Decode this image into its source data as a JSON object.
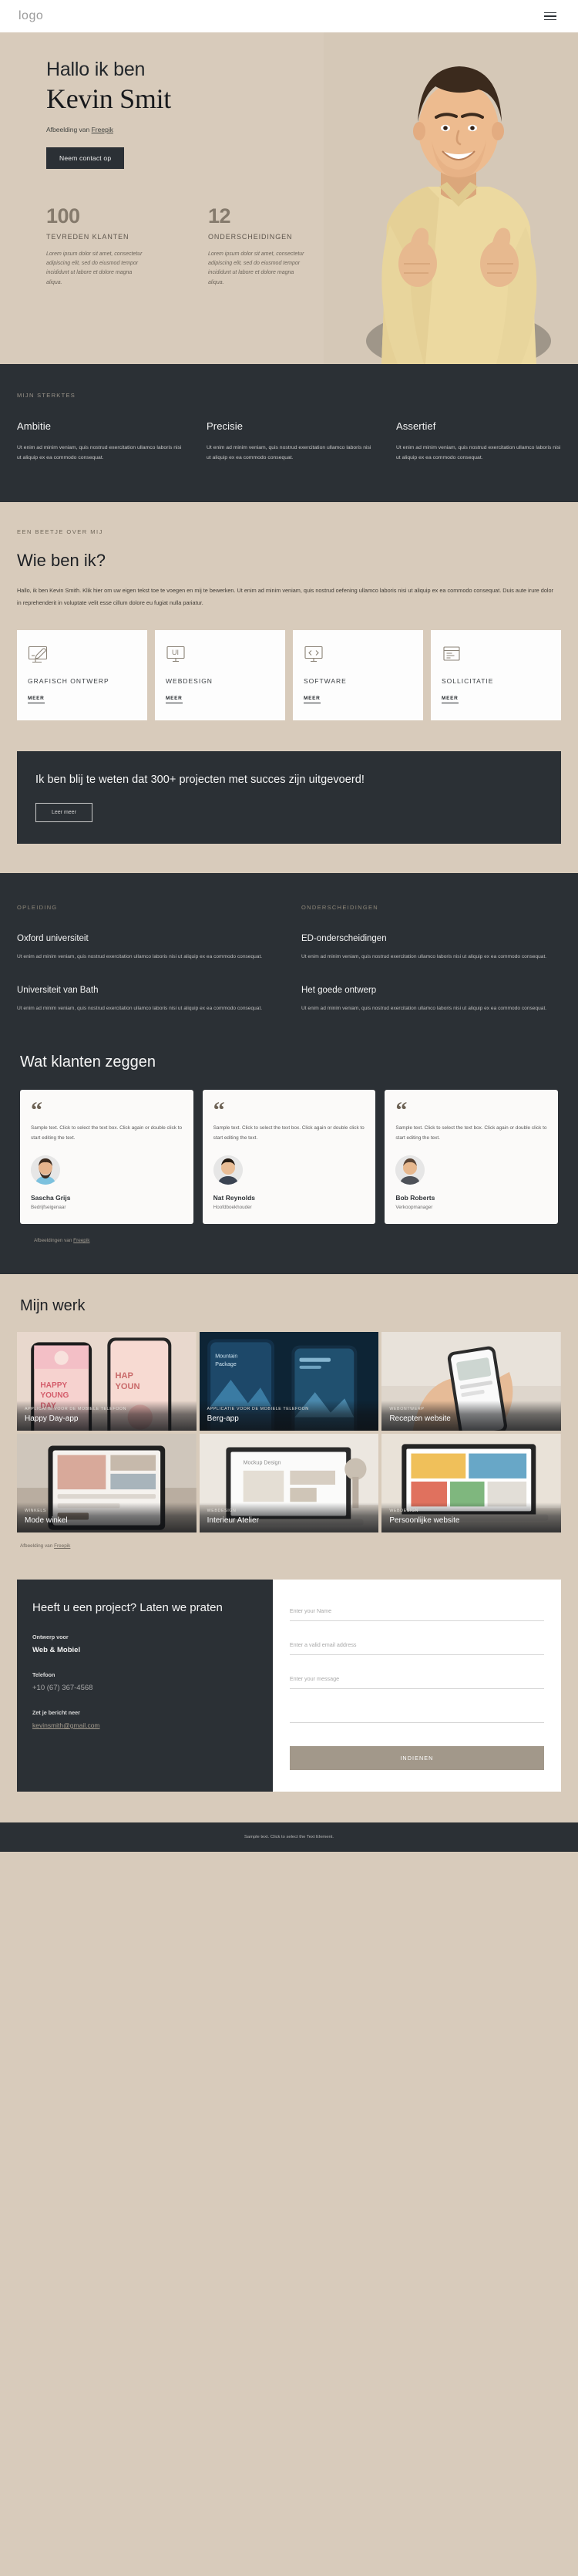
{
  "header": {
    "logo": "logo",
    "menu_icon": "hamburger-menu-icon"
  },
  "hero": {
    "greeting": "Hallo ik ben",
    "name": "Kevin Smit",
    "credit_prefix": "Afbeelding van ",
    "credit_link": "Freepik",
    "cta": "Neem contact op"
  },
  "stats": [
    {
      "number": "100",
      "label": "TEVREDEN KLANTEN",
      "desc": "Lorem ipsum dolor sit amet, consectetur adipiscing elit, sed do eiusmod tempor incididunt ut labore et dolore magna aliqua."
    },
    {
      "number": "12",
      "label": "ONDERSCHEIDINGEN",
      "desc": "Lorem ipsum dolor sit amet, consectetur adipiscing elit, sed do eiusmod tempor incididunt ut labore et dolore magna aliqua."
    }
  ],
  "strengths": {
    "eyebrow": "MIJN STERKTES",
    "items": [
      {
        "title": "Ambitie",
        "text": "Ut enim ad minim veniam, quis nostrud exercitation ullamco laboris nisi ut aliquip ex ea commodo consequat."
      },
      {
        "title": "Precisie",
        "text": "Ut enim ad minim veniam, quis nostrud exercitation ullamco laboris nisi ut aliquip ex ea commodo consequat."
      },
      {
        "title": "Assertief",
        "text": "Ut enim ad minim veniam, quis nostrud exercitation ullamco laboris nisi ut aliquip ex ea commodo consequat."
      }
    ]
  },
  "about": {
    "eyebrow": "EEN BEETJE OVER MIJ",
    "title": "Wie ben ik?",
    "paragraph": "Hallo, ik ben Kevin Smith. Klik hier om uw eigen tekst toe te voegen en mij te bewerken. Ut enim ad minim veniam, quis nostrud oefening ullamco laboris nisi ut aliquip ex ea commodo consequat. Duis aute irure dolor in reprehenderit in voluptate velit esse cillum dolore eu fugiat nulla pariatur.",
    "services": [
      {
        "icon": "graphic-design-icon",
        "title": "GRAFISCH ONTWERP",
        "more": "MEER"
      },
      {
        "icon": "ui-monitor-icon",
        "title": "WEBDESIGN",
        "more": "MEER"
      },
      {
        "icon": "code-monitor-icon",
        "title": "SOFTWARE",
        "more": "MEER"
      },
      {
        "icon": "document-icon",
        "title": "SOLLICITATIE",
        "more": "MEER"
      }
    ]
  },
  "cta_banner": {
    "title": "Ik ben blij te weten dat 300+ projecten met succes zijn uitgevoerd!",
    "button": "Leer meer"
  },
  "education": {
    "left_eyebrow": "OPLEIDING",
    "right_eyebrow": "ONDERSCHEIDINGEN",
    "left_items": [
      {
        "title": "Oxford universiteit",
        "text": "Ut enim ad minim veniam, quis nostrud exercitation ullamco laboris nisi ut aliquip ex ea commodo consequat."
      },
      {
        "title": "Universiteit van Bath",
        "text": "Ut enim ad minim veniam, quis nostrud exercitation ullamco laboris nisi ut aliquip ex ea commodo consequat."
      }
    ],
    "right_items": [
      {
        "title": "ED-onderscheidingen",
        "text": "Ut enim ad minim veniam, quis nostrud exercitation ullamco laboris nisi ut aliquip ex ea commodo consequat."
      },
      {
        "title": "Het goede ontwerp",
        "text": "Ut enim ad minim veniam, quis nostrud exercitation ullamco laboris nisi ut aliquip ex ea commodo consequat."
      }
    ]
  },
  "testimonials": {
    "title": "Wat klanten zeggen",
    "quote_glyph": "“",
    "credit_prefix": "Afbeeldingen van ",
    "credit_link": "Freepik",
    "items": [
      {
        "text": "Sample text. Click to select the text box. Click again or double click to start editing the text.",
        "name": "Sascha Grijs",
        "role": "Bedrijfseigenaar"
      },
      {
        "text": "Sample text. Click to select the text box. Click again or double click to start editing the text.",
        "name": "Nat Reynolds",
        "role": "Hoofdboekhouder"
      },
      {
        "text": "Sample text. Click to select the text box. Click again or double click to start editing the text.",
        "name": "Bob Roberts",
        "role": "Verkoopmanager"
      }
    ]
  },
  "work": {
    "title": "Mijn werk",
    "credit_prefix": "Afbeelding van ",
    "credit_link": "Freepik",
    "items": [
      {
        "category": "APPLICATIE VOOR DE MOBIELE TELEFOON",
        "title": "Happy Day-app",
        "thumb": "phone-mockup-pink"
      },
      {
        "category": "APPLICATIE VOOR DE MOBIELE TELEFOON",
        "title": "Berg-app",
        "thumb": "phone-mockup-blue"
      },
      {
        "category": "WEBONTWERP",
        "title": "Recepten website",
        "thumb": "hand-phone-photo"
      },
      {
        "category": "WINKELS",
        "title": "Mode winkel",
        "thumb": "tablet-shop-photo"
      },
      {
        "category": "WEBDESIGN",
        "title": "Interieur Atelier",
        "thumb": "laptop-interior-photo"
      },
      {
        "category": "WEBDESIGN",
        "title": "Persoonlijke website",
        "thumb": "laptop-colorful-photo"
      }
    ]
  },
  "contact": {
    "title": "Heeft u een project? Laten we praten",
    "label_service": "Ontwerp voor",
    "value_service": "Web & Mobiel",
    "label_phone": "Telefoon",
    "value_phone": "+10 (67) 367-4568",
    "label_mail": "Zet je bericht neer",
    "value_mail": "kevinsmith@gmail.com",
    "form": {
      "name_placeholder": "Enter your Name",
      "email_placeholder": "Enter a valid email address",
      "message_placeholder": "Enter your message",
      "submit": "INDIENEN"
    }
  },
  "footer": {
    "text": "Sample text. Click to select the Text Element."
  }
}
